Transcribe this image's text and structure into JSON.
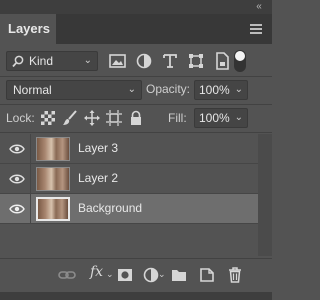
{
  "panel": {
    "tab_title": "Layers",
    "collapse_glyph": "«",
    "filter": {
      "kind_label": "Kind",
      "icons": [
        "image-filter-icon",
        "adjustment-filter-icon",
        "type-filter-icon",
        "shape-filter-icon",
        "smart-object-filter-icon"
      ]
    },
    "blend_mode": "Normal",
    "opacity": {
      "label": "Opacity:",
      "value": "100%"
    },
    "lock": {
      "label": "Lock:"
    },
    "fill": {
      "label": "Fill:",
      "value": "100%"
    },
    "layers": [
      {
        "name": "Layer 3",
        "visible": true,
        "selected": false
      },
      {
        "name": "Layer 2",
        "visible": true,
        "selected": false
      },
      {
        "name": "Background",
        "visible": true,
        "selected": true
      }
    ],
    "bottom_fx": "fx",
    "colors": {
      "panel_bg": "#535353",
      "selected_row": "#6e6e6e",
      "text": "#e8e8e8"
    }
  }
}
